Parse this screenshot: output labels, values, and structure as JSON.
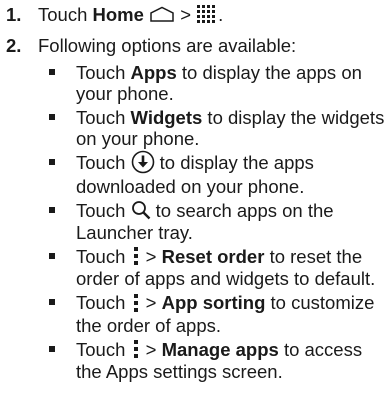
{
  "step1": {
    "number": "1.",
    "text_touch": "Touch",
    "home": "Home",
    "sep": ">",
    "end": ".",
    "icons": [
      "home-icon",
      "app-grid-icon"
    ]
  },
  "step2": {
    "number": "2.",
    "text": "Following options are available:"
  },
  "bullets": [
    {
      "pre": "Touch ",
      "bold": "Apps",
      "post": " to display the apps on your phone."
    },
    {
      "pre": "Touch ",
      "bold": "Widgets",
      "post": " to display the widgets on your phone."
    },
    {
      "pre": "Touch ",
      "icon": "download-icon",
      "post": " to display the apps downloaded on your phone."
    },
    {
      "pre": "Touch ",
      "icon": "search-icon",
      "post": " to search apps on the Launcher tray."
    },
    {
      "pre": "Touch ",
      "icon": "more-vertical-icon",
      "sep": " > ",
      "bold": "Reset order",
      "post": " to reset the order of apps and widgets to default."
    },
    {
      "pre": "Touch ",
      "icon": "more-vertical-icon",
      "sep": " > ",
      "bold": "App sorting",
      "post": " to customize the order of apps."
    },
    {
      "pre": "Touch ",
      "icon": "more-vertical-icon",
      "sep": " > ",
      "bold": "Manage apps",
      "post": " to access the Apps settings screen."
    }
  ]
}
